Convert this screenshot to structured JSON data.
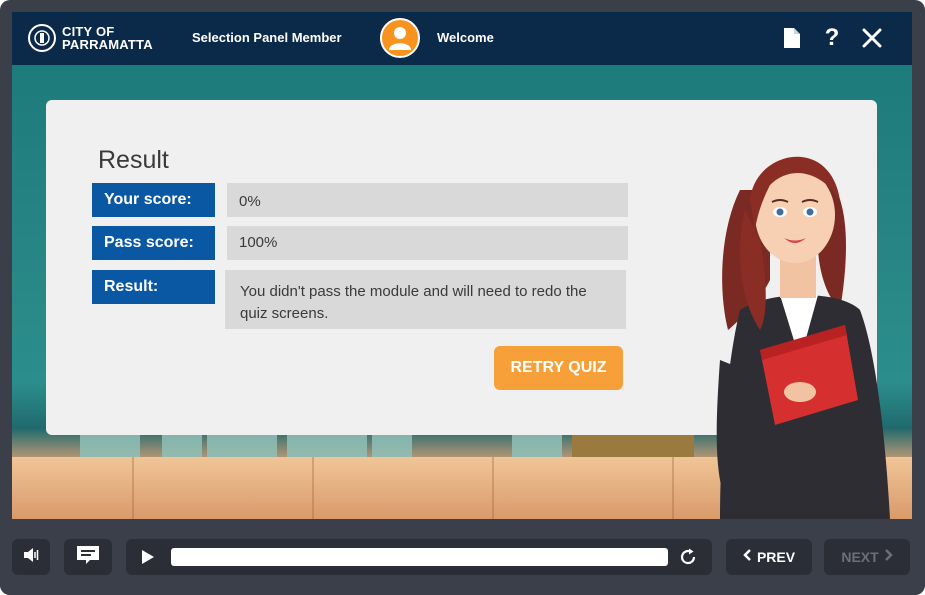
{
  "header": {
    "logo_line1": "CITY OF",
    "logo_line2": "PARRAMATTA",
    "role": "Selection Panel Member",
    "welcome": "Welcome",
    "icons": [
      "document-icon",
      "help-icon",
      "close-icon"
    ],
    "help_glyph": "?"
  },
  "result": {
    "title": "Result",
    "rows": [
      {
        "label": "Your score:",
        "value": "0%"
      },
      {
        "label": "Pass score:",
        "value": "100%"
      },
      {
        "label": "Result:",
        "value": "You didn't pass the module and will need to redo the quiz screens."
      }
    ],
    "retry_label": "RETRY QUIZ"
  },
  "controls": {
    "prev_label": "PREV",
    "next_label": "NEXT",
    "progress": 0,
    "next_enabled": false
  },
  "colors": {
    "header_bg": "#0b2a49",
    "label_blue": "#0a57a4",
    "retry_orange": "#f7a03a",
    "avatar_orange": "#f7931e",
    "player_gray": "#3b3f4a"
  }
}
